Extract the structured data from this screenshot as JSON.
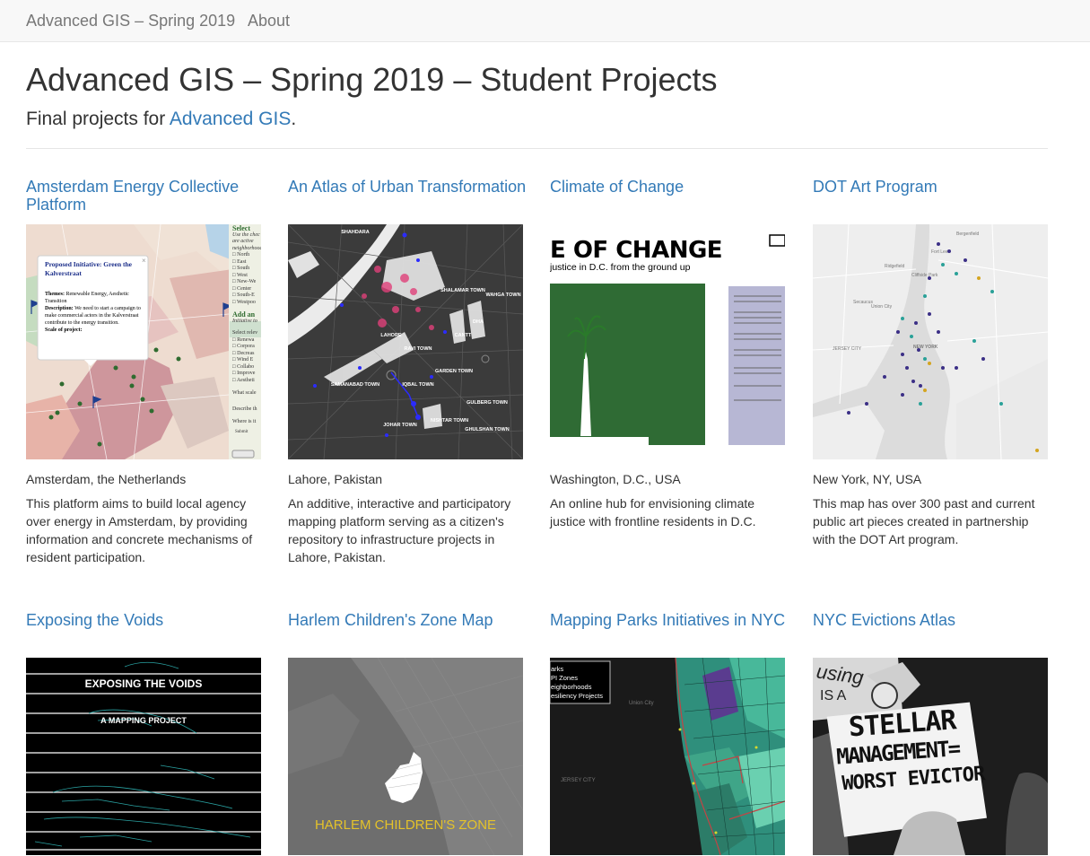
{
  "navbar": {
    "brand": "Advanced GIS – Spring 2019",
    "about": "About"
  },
  "header": {
    "title": "Advanced GIS – Spring 2019 – Student Projects",
    "lead_prefix": "Final projects for ",
    "lead_link": "Advanced GIS",
    "lead_suffix": "."
  },
  "projects": [
    {
      "title": "Amsterdam Energy Collective Platform",
      "location": "Amsterdam, the Netherlands",
      "description": "This platform aims to build local agency over energy in Amsterdam, by providing information and concrete mechanisms of resident participation.",
      "thumb": {
        "popup_title": "Proposed Initiative: Green the Kalverstraat",
        "popup_themes_label": "Themes:",
        "popup_themes": "Renewable Energy, Aesthetic Transition",
        "popup_desc_label": "Description:",
        "popup_desc": "We need to start a campaign to make commercial actors in the Kalverstraat contribute to the energy transition.",
        "popup_scale": "Scale of project:",
        "side_head": "Select",
        "side_intro_1": "Use the chec",
        "side_intro_2": "are active",
        "side_intro_3": "neighborhood",
        "side_opts": [
          "North",
          "East",
          "South",
          "West",
          "New-We",
          "Center",
          "South-E",
          "Westpoo"
        ],
        "add_head": "Add an",
        "add_intro": "Initiative to",
        "add_select": "Select relev",
        "add_opts": [
          "Renewa",
          "Corpora",
          "Decreas",
          "Wind E",
          "Collabo",
          "Improve",
          "Aestheti"
        ],
        "add_q1": "What scale",
        "add_q2": "Describe th",
        "add_q3": "Where is it",
        "submit": "Submit"
      }
    },
    {
      "title": "An Atlas of Urban Transformation",
      "location": "Lahore, Pakistan",
      "description": "An additive, interactive and participatory mapping platform serving as a citizen's repository to infrastructure projects in Lahore, Pakistan.",
      "thumb": {
        "labels": [
          "SHAHDARA",
          "LAHORE",
          "SHALAMAR TOWN",
          "GARDEN TOWN",
          "SAMANABAD TOWN",
          "WAHGA TOWN",
          "CANTT",
          "JOHAR TOWN",
          "IQBAL TOWN",
          "GULBERG TOWN",
          "GHULSHAN TOWN",
          "RAVI TOWN",
          "DHA",
          "NISHTAR TOWN"
        ]
      }
    },
    {
      "title": "Climate of Change",
      "location": "Washington, D.C., USA",
      "description": "An online hub for envisioning climate justice with frontline residents in D.C.",
      "thumb": {
        "banner": "E OF CHANGE",
        "subtitle": "justice in D.C. from the ground up"
      }
    },
    {
      "title": "DOT Art Program",
      "location": "New York, NY, USA",
      "description": "This map has over 300 past and current public art pieces created in partnership with the DOT Art program.",
      "thumb": {
        "labels": [
          "Fort Lee",
          "Cliffside Park",
          "Secaucus",
          "Union City",
          "NEW YORK",
          "JERSEY CITY",
          "Ridgefield",
          "Bergenfield"
        ]
      }
    },
    {
      "title": "Exposing the Voids",
      "location": "",
      "description": "",
      "thumb": {
        "heading": "EXPOSING THE VOIDS",
        "subheading": "A MAPPING PROJECT"
      }
    },
    {
      "title": "Harlem Children's Zone Map",
      "location": "",
      "description": "",
      "thumb": {
        "caption": "HARLEM CHILDREN'S ZONE"
      }
    },
    {
      "title": "Mapping Parks Initiatives in NYC",
      "location": "",
      "description": "",
      "thumb": {
        "legend": [
          "arks",
          "PI Zones",
          "eighborhoods",
          "esiliency Projects"
        ],
        "labels": [
          "JERSEY CITY",
          "Union City"
        ]
      }
    },
    {
      "title": "NYC Evictions Atlas",
      "location": "",
      "description": "",
      "thumb": {
        "sign_lines": [
          "STELLAR",
          "MANAGEMENT=",
          "WORST EVICTOR"
        ],
        "top_text": "using",
        "is_a": "IS A"
      }
    }
  ]
}
